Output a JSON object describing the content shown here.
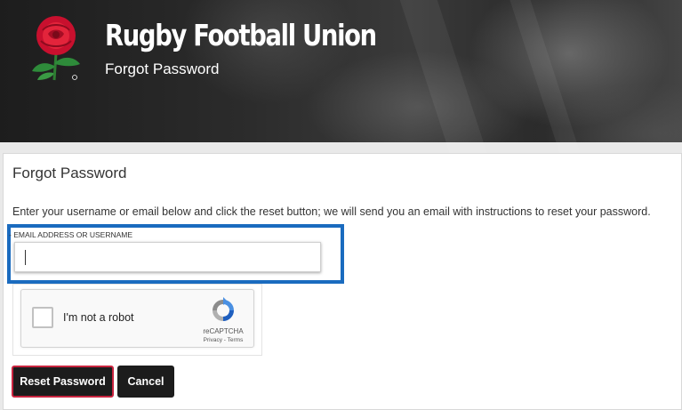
{
  "header": {
    "title": "Rugby Football Union",
    "subtitle": "Forgot Password",
    "logo": "red-rose-icon"
  },
  "form": {
    "heading": "Forgot Password",
    "instructions": "Enter your username or email below and click the reset button; we will send you an email with instructions to reset your password.",
    "field_label": "- EMAIL ADDRESS OR USERNAME",
    "field_value": "",
    "highlight_color": "#1a6bbf"
  },
  "captcha": {
    "label": "I'm not a robot",
    "brand": "reCAPTCHA",
    "links": "Privacy - Terms",
    "icon": "recaptcha-icon"
  },
  "buttons": {
    "reset": "Reset Password",
    "cancel": "Cancel",
    "reset_border_color": "#c9243f"
  }
}
